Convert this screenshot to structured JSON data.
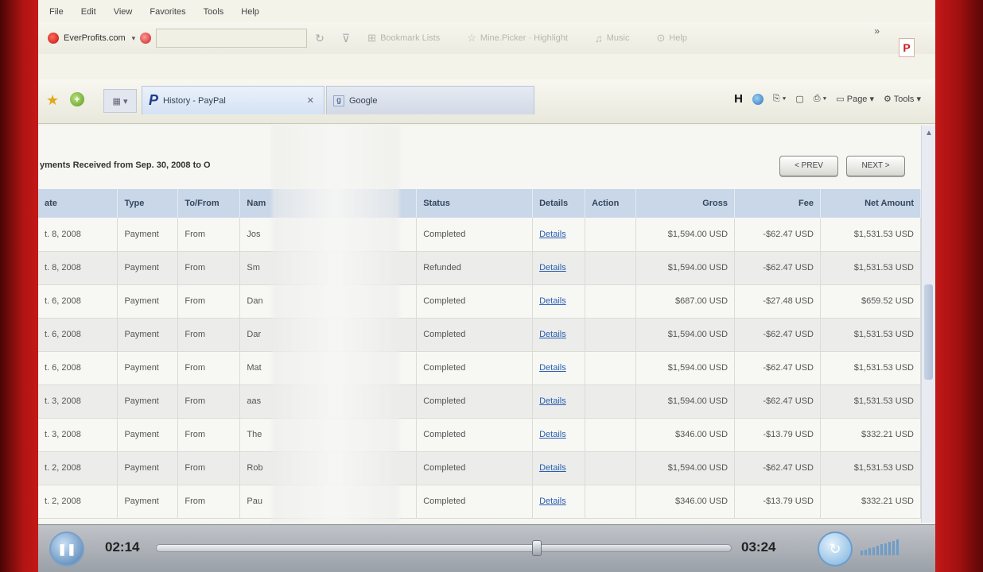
{
  "menubar": {
    "items": [
      "File",
      "Edit",
      "View",
      "Favorites",
      "Tools",
      "Help"
    ]
  },
  "navbar": {
    "site": "EverProfits.com",
    "items": [
      "Bookmark Lists",
      "Mine.Picker · Highlight",
      "Music",
      "Help"
    ]
  },
  "tabs": [
    {
      "title": "History - PayPal",
      "active": true
    },
    {
      "title": "Google",
      "active": false
    }
  ],
  "toolbar": {
    "page_label": "Page",
    "tools_label": "Tools"
  },
  "report": {
    "title": "yments Received from Sep. 30, 2008 to O",
    "prev_label": "< PREV",
    "next_label": "NEXT >"
  },
  "table": {
    "headers": [
      "ate",
      "Type",
      "To/From",
      "Nam",
      "Status",
      "Details",
      "Action",
      "Gross",
      "Fee",
      "Net Amount"
    ],
    "rows": [
      [
        "t. 8, 2008",
        "Payment",
        "From",
        "Jos",
        "Completed",
        "Details",
        "",
        "$1,594.00 USD",
        "-$62.47 USD",
        "$1,531.53 USD"
      ],
      [
        "t. 8, 2008",
        "Payment",
        "From",
        "Sm",
        "Refunded",
        "Details",
        "",
        "$1,594.00 USD",
        "-$62.47 USD",
        "$1,531.53 USD"
      ],
      [
        "t. 6, 2008",
        "Payment",
        "From",
        "Dan",
        "Completed",
        "Details",
        "",
        "$687.00 USD",
        "-$27.48 USD",
        "$659.52 USD"
      ],
      [
        "t. 6, 2008",
        "Payment",
        "From",
        "Dar",
        "Completed",
        "Details",
        "",
        "$1,594.00 USD",
        "-$62.47 USD",
        "$1,531.53 USD"
      ],
      [
        "t. 6, 2008",
        "Payment",
        "From",
        "Mat",
        "Completed",
        "Details",
        "",
        "$1,594.00 USD",
        "-$62.47 USD",
        "$1,531.53 USD"
      ],
      [
        "t. 3, 2008",
        "Payment",
        "From",
        "aas",
        "Completed",
        "Details",
        "",
        "$1,594.00 USD",
        "-$62.47 USD",
        "$1,531.53 USD"
      ],
      [
        "t. 3, 2008",
        "Payment",
        "From",
        "The",
        "Completed",
        "Details",
        "",
        "$346.00 USD",
        "-$13.79 USD",
        "$332.21 USD"
      ],
      [
        "t. 2, 2008",
        "Payment",
        "From",
        "Rob",
        "Completed",
        "Details",
        "",
        "$1,594.00 USD",
        "-$62.47 USD",
        "$1,531.53 USD"
      ],
      [
        "t. 2, 2008",
        "Payment",
        "From",
        "Pau",
        "Completed",
        "Details",
        "",
        "$346.00 USD",
        "-$13.79 USD",
        "$332.21 USD"
      ]
    ]
  },
  "player": {
    "elapsed": "02:14",
    "total": "03:24",
    "progress": 0.66
  },
  "colors": {
    "frame": "#b01414",
    "table_header": "#c9d7e8",
    "link": "#2a5fb0"
  }
}
